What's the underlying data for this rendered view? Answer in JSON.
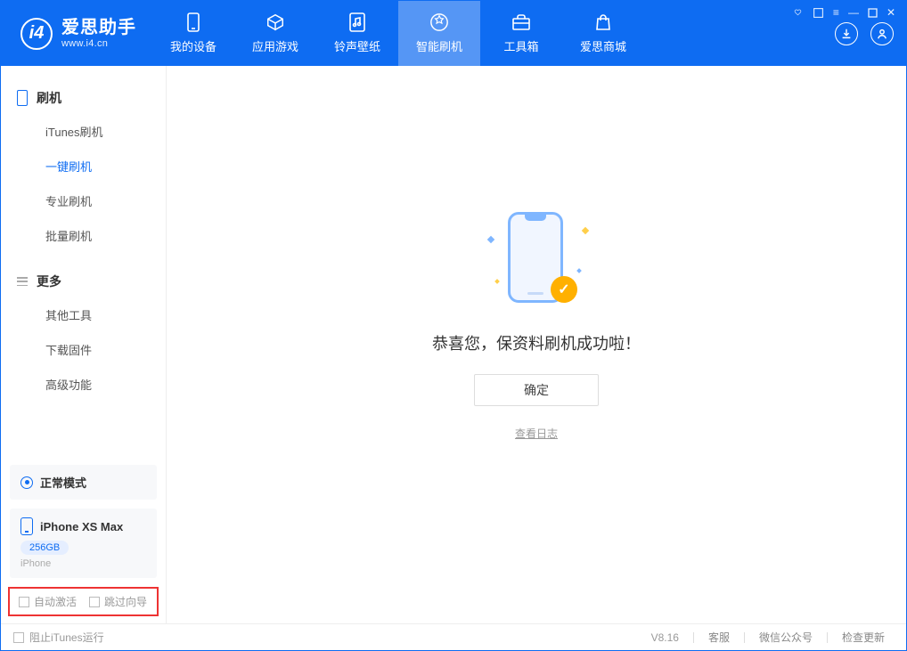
{
  "app": {
    "title": "爱思助手",
    "url": "www.i4.cn"
  },
  "header_tabs": [
    {
      "label": "我的设备",
      "icon": "device-icon"
    },
    {
      "label": "应用游戏",
      "icon": "apps-icon"
    },
    {
      "label": "铃声壁纸",
      "icon": "ringtone-icon"
    },
    {
      "label": "智能刷机",
      "icon": "flash-icon",
      "active": true
    },
    {
      "label": "工具箱",
      "icon": "toolbox-icon"
    },
    {
      "label": "爱思商城",
      "icon": "store-icon"
    }
  ],
  "sidebar": {
    "group1": {
      "title": "刷机"
    },
    "group1_items": [
      {
        "label": "iTunes刷机"
      },
      {
        "label": "一键刷机",
        "active": true
      },
      {
        "label": "专业刷机"
      },
      {
        "label": "批量刷机"
      }
    ],
    "group2": {
      "title": "更多"
    },
    "group2_items": [
      {
        "label": "其他工具"
      },
      {
        "label": "下载固件"
      },
      {
        "label": "高级功能"
      }
    ]
  },
  "device_status": {
    "mode_label": "正常模式"
  },
  "device": {
    "name": "iPhone XS Max",
    "storage": "256GB",
    "sub": "iPhone"
  },
  "options": {
    "auto_activate": "自动激活",
    "skip_wizard": "跳过向导"
  },
  "main": {
    "success_message": "恭喜您，保资料刷机成功啦！",
    "ok_label": "确定",
    "view_log": "查看日志"
  },
  "footer": {
    "block_itunes": "阻止iTunes运行",
    "version": "V8.16",
    "links": [
      "客服",
      "微信公众号",
      "检查更新"
    ]
  }
}
